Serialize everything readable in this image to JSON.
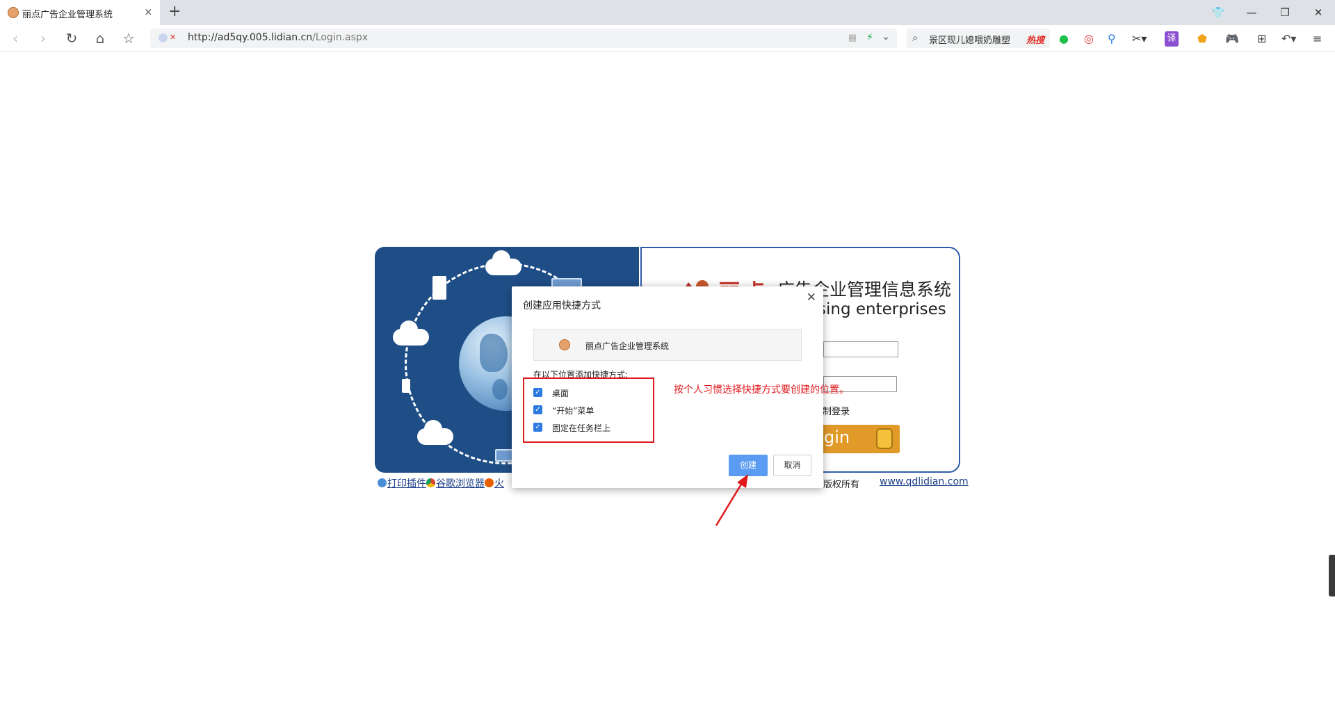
{
  "browser": {
    "tab_title": "丽点广告企业管理系统",
    "tab_close": "×",
    "new_tab": "+",
    "url_host": "http://ad5qy.005.lidian.cn",
    "url_path": "/Login.aspx",
    "search_query": "景区现儿媳喂奶雕塑",
    "search_hot": "热搜",
    "translate_ext": "译"
  },
  "login": {
    "brand": "丽点",
    "title": "广告企业管理信息系统",
    "subtitle": "sing enterprises",
    "remember_label": "制登录",
    "login_button": "gin",
    "footer_print": "打印插件",
    "footer_chrome": "谷歌浏览器",
    "footer_fire": "火",
    "copyright": "版权所有",
    "site": "www.qdlidian.com"
  },
  "dialog": {
    "title": "创建应用快捷方式",
    "app_name": "丽点广告企业管理系统",
    "location_label": "在以下位置添加快捷方式:",
    "options": [
      {
        "label": "桌面",
        "checked": true
      },
      {
        "label": "“开始”菜单",
        "checked": true
      },
      {
        "label": "固定在任务栏上",
        "checked": true
      }
    ],
    "create_button": "创建",
    "cancel_button": "取消"
  },
  "annotation": {
    "text": "按个人习惯选择快捷方式要创建的位置。",
    "color": "#e0181c"
  },
  "colors": {
    "accent_blue": "#2d7be0",
    "login_orange": "#e19a28",
    "card_navy": "#1f4e87"
  }
}
